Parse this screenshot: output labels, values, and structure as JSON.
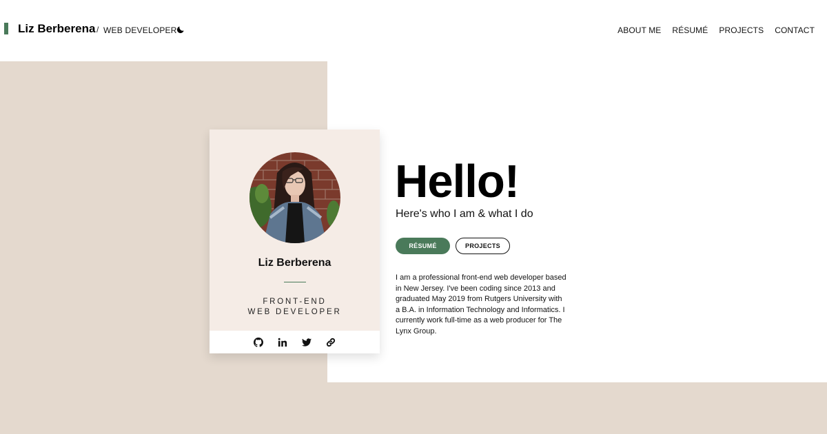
{
  "header": {
    "name": "Liz Berberena",
    "separator": "/",
    "role": "WEB DEVELOPER",
    "theme_toggle_icon": "moon-icon",
    "accent_color": "#4a7a5a",
    "nav": [
      {
        "label": "ABOUT ME"
      },
      {
        "label": "RÉSUMÉ"
      },
      {
        "label": "PROJECTS"
      },
      {
        "label": "CONTACT"
      }
    ]
  },
  "card": {
    "name": "Liz Berberena",
    "role_line1": "FRONT-END",
    "role_line2": "WEB DEVELOPER",
    "social_icons": [
      "github-icon",
      "linkedin-icon",
      "twitter-icon",
      "link-icon"
    ]
  },
  "intro": {
    "heading": "Hello!",
    "subtitle": "Here's who I am & what I do",
    "resume_button": "RÉSUMÉ",
    "projects_button": "PROJECTS",
    "about": "I am a professional front-end web developer based in New Jersey. I've been coding since 2013 and graduated May 2019 from Rutgers University with a B.A. in Information Technology and Informatics. I currently work full-time as a web producer for The Lynx Group."
  },
  "colors": {
    "background_beige": "#e4d9ce",
    "card_background": "#f5ece6",
    "accent_green": "#4a7a5a"
  }
}
